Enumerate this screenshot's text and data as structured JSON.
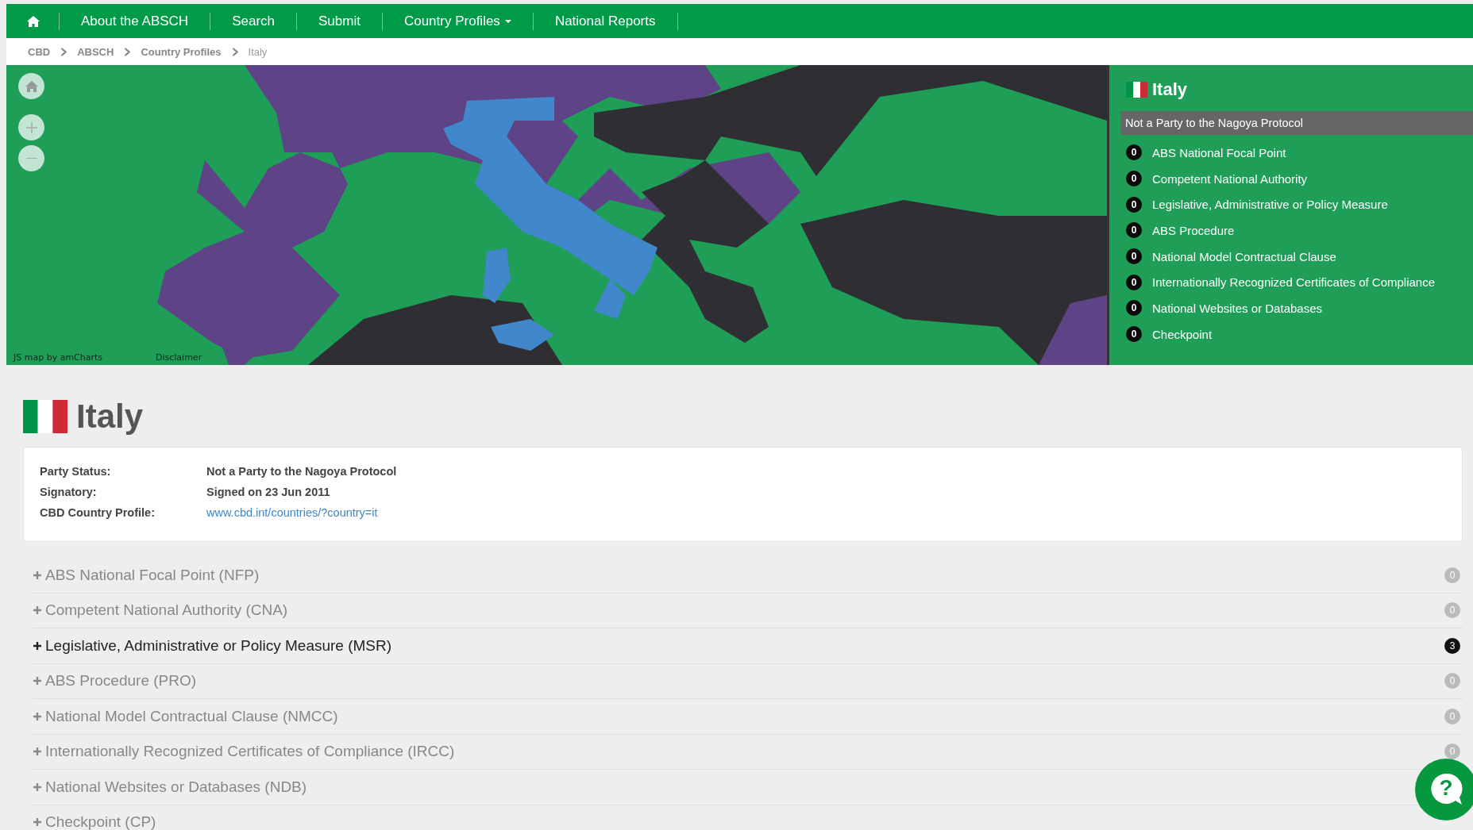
{
  "nav": {
    "items": [
      {
        "label": "About the ABSCH",
        "dropdown": false
      },
      {
        "label": "Search",
        "dropdown": false
      },
      {
        "label": "Submit",
        "dropdown": false
      },
      {
        "label": "Country Profiles",
        "dropdown": true
      },
      {
        "label": "National Reports",
        "dropdown": false
      }
    ]
  },
  "breadcrumb": [
    "CBD",
    "ABSCH",
    "Country Profiles",
    "Italy"
  ],
  "map": {
    "credit": "JS map by amCharts",
    "disclaimer": "Disclaimer"
  },
  "panel": {
    "country": "Italy",
    "status": "Not a Party to the Nagoya Protocol",
    "items": [
      {
        "count": "0",
        "label": "ABS National Focal Point"
      },
      {
        "count": "0",
        "label": "Competent National Authority"
      },
      {
        "count": "0",
        "label": "Legislative, Administrative or Policy Measure"
      },
      {
        "count": "0",
        "label": "ABS Procedure"
      },
      {
        "count": "0",
        "label": "National Model Contractual Clause"
      },
      {
        "count": "0",
        "label": "Internationally Recognized Certificates of Compliance"
      },
      {
        "count": "0",
        "label": "National Websites or Databases"
      },
      {
        "count": "0",
        "label": "Checkpoint"
      }
    ]
  },
  "profile": {
    "country": "Italy",
    "fields": [
      {
        "label": "Party Status:",
        "value": "Not a Party to the Nagoya Protocol",
        "kind": "text"
      },
      {
        "label": "Signatory:",
        "value": "Signed on 23 Jun 2011",
        "kind": "text"
      },
      {
        "label": "CBD Country Profile:",
        "value": "www.cbd.int/countries/?country=it",
        "kind": "link"
      }
    ]
  },
  "help": {
    "icon": "?"
  },
  "sections": [
    {
      "label": "ABS National Focal Point (NFP)",
      "count": "0",
      "highlighted": false
    },
    {
      "label": "Competent National Authority (CNA)",
      "count": "0",
      "highlighted": false
    },
    {
      "label": "Legislative, Administrative or Policy Measure (MSR)",
      "count": "3",
      "highlighted": true
    },
    {
      "label": "ABS Procedure (PRO)",
      "count": "0",
      "highlighted": false
    },
    {
      "label": "National Model Contractual Clause (NMCC)",
      "count": "0",
      "highlighted": false
    },
    {
      "label": "Internationally Recognized Certificates of Compliance (IRCC)",
      "count": "0",
      "highlighted": false
    },
    {
      "label": "National Websites or Databases (NDB)",
      "highlighted": false
    },
    {
      "label": "Checkpoint (CP)",
      "highlighted": false
    }
  ]
}
